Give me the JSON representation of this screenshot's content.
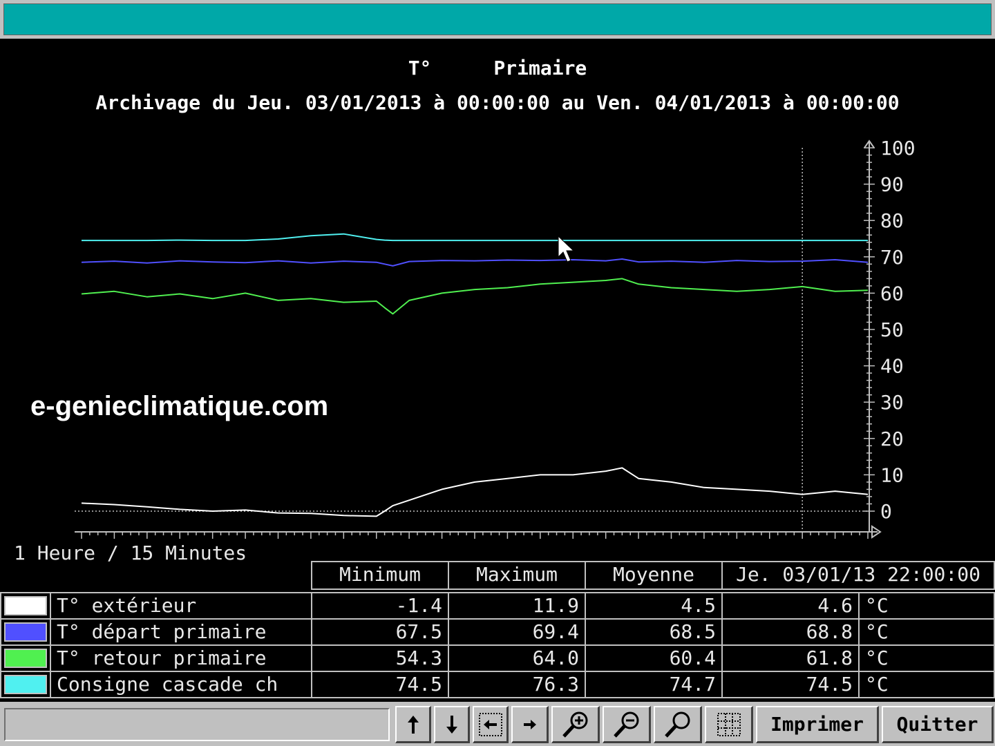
{
  "header": {
    "title_left": "T°",
    "title_right": "Primaire",
    "archive_line": "Archivage du Jeu. 03/01/2013 à 00:00:00 au Ven. 04/01/2013 à 00:00:00"
  },
  "watermark": "e-genieclimatique.com",
  "resolution_label": "1 Heure / 15 Minutes",
  "colors": {
    "exterieur": "#ffffff",
    "depart": "#5050ff",
    "retour": "#50f050",
    "consigne": "#50f0f0",
    "titlebar": "#00a8a8"
  },
  "table": {
    "headers": {
      "min": "Minimum",
      "max": "Maximum",
      "avg": "Moyenne",
      "cursor": "Je. 03/01/13 22:00:00"
    },
    "rows": [
      {
        "label": "T° extérieur",
        "min": "-1.4",
        "max": "11.9",
        "avg": "4.5",
        "cursor": "4.6",
        "unit": "°C",
        "color": "#ffffff"
      },
      {
        "label": "T° départ primaire",
        "min": "67.5",
        "max": "69.4",
        "avg": "68.5",
        "cursor": "68.8",
        "unit": "°C",
        "color": "#5050ff"
      },
      {
        "label": "T° retour primaire",
        "min": "54.3",
        "max": "64.0",
        "avg": "60.4",
        "cursor": "61.8",
        "unit": "°C",
        "color": "#50f050"
      },
      {
        "label": "Consigne cascade ch",
        "min": "74.5",
        "max": "76.3",
        "avg": "74.7",
        "cursor": "74.5",
        "unit": "°C",
        "color": "#50f0f0"
      }
    ]
  },
  "toolbar": {
    "print_label": "Imprimer",
    "quit_label": "Quitter",
    "icons": [
      "arrow-up-icon",
      "arrow-down-icon",
      "arrow-left-icon",
      "arrow-right-icon",
      "zoom-in-icon",
      "zoom-out-icon",
      "zoom-icon",
      "grid-icon"
    ]
  },
  "chart_data": {
    "type": "line",
    "x_range": [
      0,
      24
    ],
    "x_unit": "hours",
    "cursor_x": 22,
    "ylim": [
      0,
      100
    ],
    "yticks": [
      0,
      10,
      20,
      30,
      40,
      50,
      60,
      70,
      80,
      90,
      100
    ],
    "grid": false,
    "x": [
      0,
      1,
      2,
      3,
      4,
      5,
      6,
      7,
      8,
      9,
      9.25,
      9.5,
      10,
      11,
      12,
      13,
      14,
      15,
      16,
      16.5,
      17,
      18,
      19,
      20,
      21,
      22,
      23,
      24
    ],
    "series": [
      {
        "name": "T° extérieur",
        "color": "#ffffff",
        "values": [
          2.2,
          1.8,
          1.2,
          0.5,
          0.0,
          0.3,
          -0.5,
          -0.6,
          -1.2,
          -1.4,
          0.0,
          1.5,
          3.0,
          6.0,
          8.0,
          9.0,
          10.0,
          10.0,
          11.0,
          11.9,
          9.0,
          8.0,
          6.5,
          6.0,
          5.5,
          4.6,
          5.5,
          4.6
        ]
      },
      {
        "name": "T° départ primaire",
        "color": "#5050ff",
        "values": [
          68.5,
          68.8,
          68.3,
          68.9,
          68.6,
          68.4,
          68.9,
          68.3,
          68.8,
          68.5,
          68.0,
          67.5,
          68.7,
          69.0,
          68.9,
          69.1,
          69.0,
          69.2,
          68.9,
          69.4,
          68.6,
          68.8,
          68.5,
          69.0,
          68.7,
          68.8,
          69.2,
          68.5
        ]
      },
      {
        "name": "T° retour primaire",
        "color": "#50f050",
        "values": [
          59.8,
          60.5,
          59.0,
          59.8,
          58.5,
          60.0,
          58.0,
          58.5,
          57.5,
          57.8,
          56.0,
          54.3,
          58.0,
          60.0,
          61.0,
          61.5,
          62.5,
          63.0,
          63.5,
          64.0,
          62.5,
          61.5,
          61.0,
          60.5,
          61.0,
          61.8,
          60.5,
          60.8
        ]
      },
      {
        "name": "Consigne cascade ch",
        "color": "#50f0f0",
        "values": [
          74.5,
          74.5,
          74.5,
          74.6,
          74.5,
          74.5,
          74.9,
          75.8,
          76.3,
          74.8,
          74.6,
          74.5,
          74.5,
          74.5,
          74.5,
          74.5,
          74.5,
          74.5,
          74.5,
          74.5,
          74.5,
          74.5,
          74.5,
          74.5,
          74.5,
          74.5,
          74.5,
          74.5
        ]
      }
    ]
  }
}
